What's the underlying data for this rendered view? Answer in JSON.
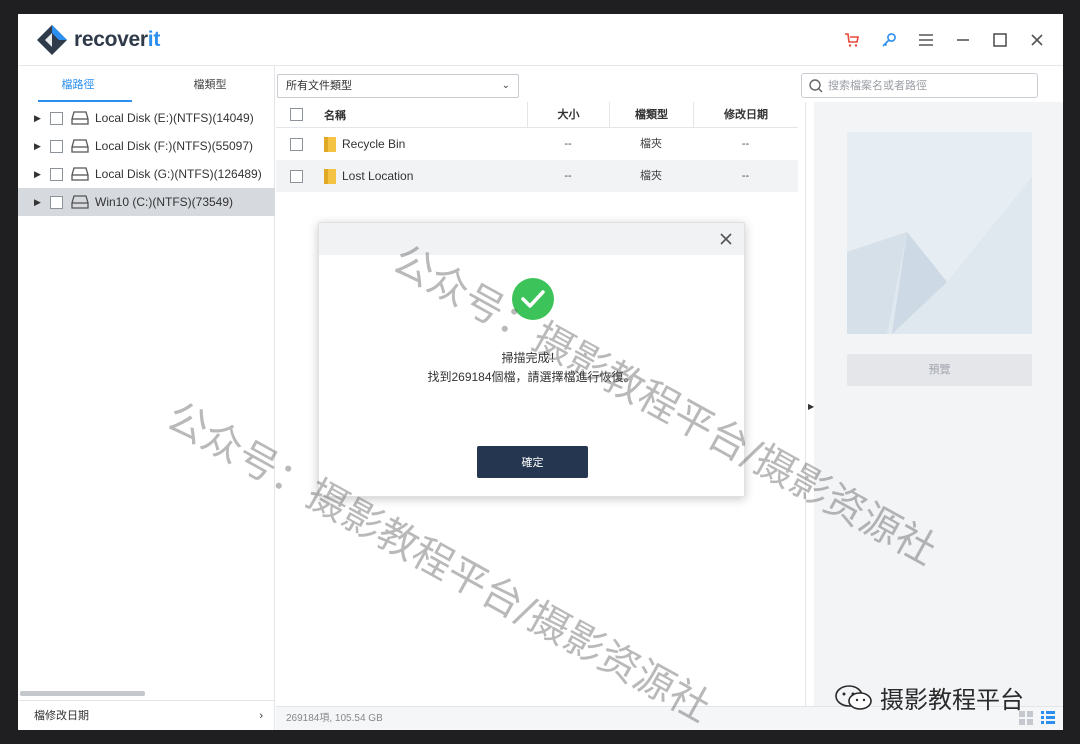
{
  "app": {
    "name_prefix": "recover",
    "name_suffix": "it"
  },
  "titlebar": {
    "icons": [
      "cart-icon",
      "key-icon",
      "menu-icon",
      "minimize-icon",
      "maximize-icon",
      "close-icon"
    ]
  },
  "left": {
    "tabs": [
      {
        "label": "檔路徑",
        "active": true
      },
      {
        "label": "檔類型",
        "active": false
      }
    ],
    "tree": [
      {
        "label": "Local Disk (E:)(NTFS)(14049)",
        "selected": false
      },
      {
        "label": "Local Disk (F:)(NTFS)(55097)",
        "selected": false
      },
      {
        "label": "Local Disk (G:)(NTFS)(126489)",
        "selected": false
      },
      {
        "label": "Win10 (C:)(NTFS)(73549)",
        "selected": true
      }
    ],
    "footer": {
      "label": "檔修改日期",
      "arrow": "›"
    }
  },
  "toolbar": {
    "filter_value": "所有文件類型",
    "search_placeholder": "搜索檔案名或者路徑"
  },
  "table": {
    "headers": {
      "name": "名稱",
      "size": "大小",
      "type": "檔類型",
      "date": "修改日期"
    },
    "rows": [
      {
        "name": "Recycle Bin",
        "size": "--",
        "type": "檔夾",
        "date": "--"
      },
      {
        "name": "Lost Location",
        "size": "--",
        "type": "檔夾",
        "date": "--"
      }
    ]
  },
  "preview": {
    "button": "預覽"
  },
  "status": {
    "text": "269184項, 105.54  GB"
  },
  "modal": {
    "line1": "掃描完成！",
    "line2": "找到269184個檔，請選擇檔進行恢復。",
    "ok": "確定"
  },
  "watermark": {
    "text1": "公众号：摄影教程平台/摄影资源社",
    "text2": "公众号：摄影教程平台/摄影资源社",
    "corner": "摄影教程平台"
  },
  "colors": {
    "accent": "#2b8ff0",
    "primary_button": "#253650",
    "success": "#3cc35a",
    "cart": "#e8493a"
  }
}
